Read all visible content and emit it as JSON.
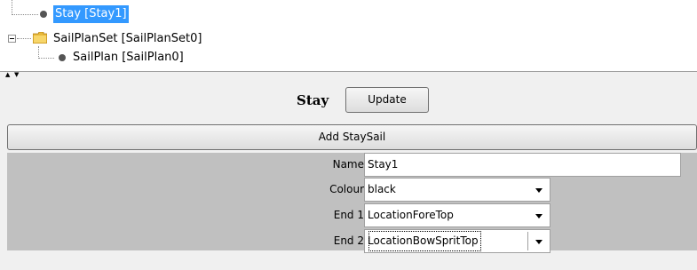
{
  "tree": {
    "items": [
      {
        "label": "Stay [Stay1]",
        "selected": true,
        "icon": "node-dot-icon"
      },
      {
        "label": "SailPlanSet [SailPlanSet0]",
        "selected": false,
        "icon": "folder-icon"
      },
      {
        "label": "SailPlan [SailPlan0]",
        "selected": false,
        "icon": "node-dot-icon"
      }
    ]
  },
  "splitter": {
    "up_arrow": "▲",
    "down_arrow": "▼"
  },
  "panel": {
    "title": "Stay",
    "update_label": "Update",
    "add_staysail_label": "Add StaySail",
    "fields": {
      "name_label": "Name",
      "name_value": "Stay1",
      "colour_label": "Colour",
      "colour_value": "black",
      "end1_label": "End 1",
      "end1_value": "LocationForeTop",
      "end2_label": "End 2",
      "end2_value": "LocationBowSpritTop"
    }
  },
  "colors": {
    "selection": "#3399ff",
    "form_bg": "#c0c0c0",
    "panel_bg": "#f0f0f0"
  }
}
